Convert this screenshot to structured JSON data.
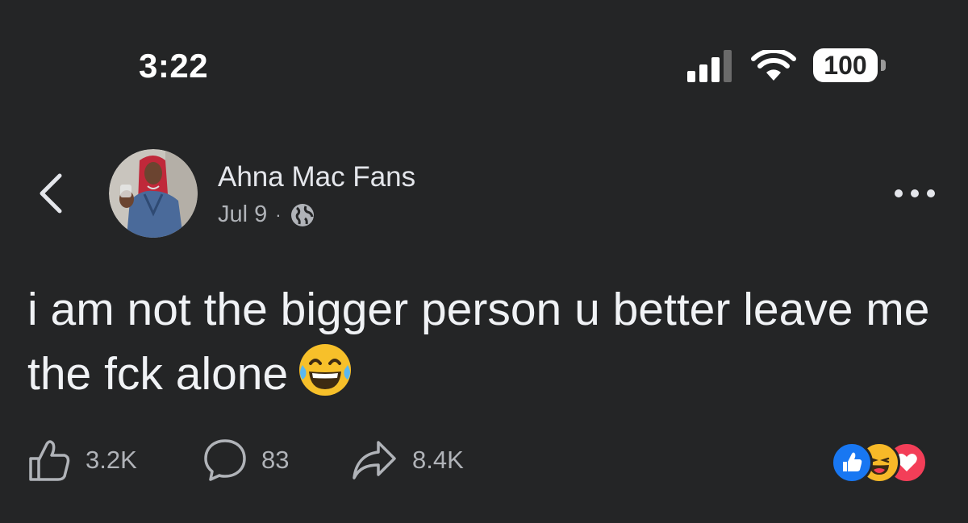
{
  "status_bar": {
    "time": "3:22",
    "battery": "100",
    "icons": [
      "signal-icon",
      "wifi-icon",
      "battery-icon"
    ]
  },
  "header": {
    "page_name": "Ahna Mac Fans",
    "date": "Jul 9",
    "separator": "·",
    "privacy_icon": "globe-icon",
    "back_icon": "chevron-left-icon",
    "more_icon": "more-options-icon"
  },
  "post": {
    "text": "i am not the bigger person u better leave me the fck alone",
    "emoji": "laughing-tears-emoji"
  },
  "actions": {
    "like_count": "3.2K",
    "comment_count": "83",
    "share_count": "8.4K"
  },
  "reactions": [
    "like",
    "haha",
    "love"
  ],
  "colors": {
    "background": "#242526",
    "primary_text": "#e4e6eb",
    "secondary_text": "#b0b3b8",
    "like_blue": "#1877f2",
    "haha_yellow": "#f7b928",
    "love_red": "#f33e58"
  }
}
